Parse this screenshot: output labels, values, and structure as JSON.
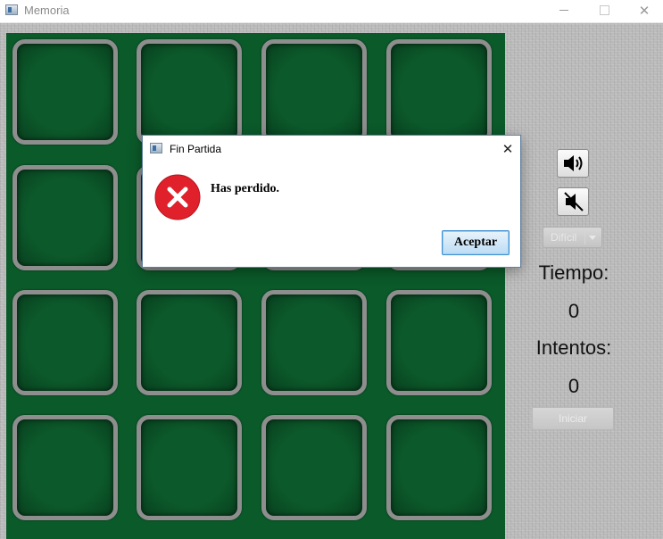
{
  "window": {
    "title": "Memoria",
    "icon": "java-window-icon",
    "controls": {
      "minimize": "minimize-icon",
      "maximize": "maximize-icon",
      "close": "close-icon"
    }
  },
  "board": {
    "background_color": "#0b5a2a",
    "card_border_color": "#8e8e8e",
    "rows": 4,
    "columns": 4,
    "cards": [
      "face-down",
      "face-down",
      "face-down",
      "face-down",
      "face-down",
      "face-down",
      "face-down",
      "face-down",
      "face-down",
      "face-down",
      "face-down",
      "face-down",
      "face-down",
      "face-down",
      "face-down",
      "face-down"
    ]
  },
  "controls": {
    "sound_on_icon": "speaker-on-icon",
    "sound_off_icon": "speaker-muted-icon",
    "difficulty": {
      "selected": "Difícil",
      "enabled": false
    },
    "time_label": "Tiempo:",
    "time_value": "0",
    "attempts_label": "Intentos:",
    "attempts_value": "0",
    "start_label": "Iniciar",
    "start_enabled": false
  },
  "dialog": {
    "title": "Fin Partida",
    "message": "Has perdido.",
    "icon": "error-icon",
    "ok_label": "Aceptar",
    "accent_color": "#e0202a"
  }
}
